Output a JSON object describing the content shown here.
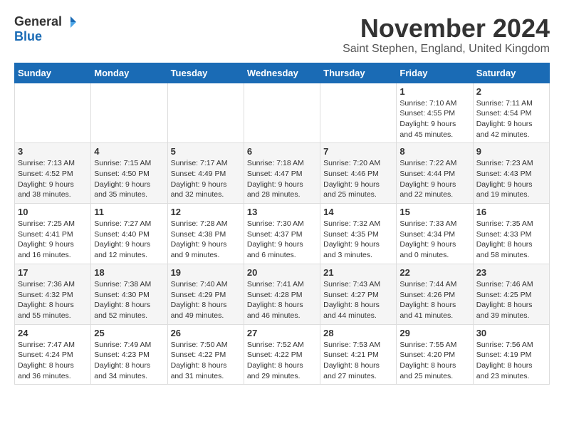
{
  "header": {
    "logo_general": "General",
    "logo_blue": "Blue",
    "month_title": "November 2024",
    "location": "Saint Stephen, England, United Kingdom"
  },
  "weekdays": [
    "Sunday",
    "Monday",
    "Tuesday",
    "Wednesday",
    "Thursday",
    "Friday",
    "Saturday"
  ],
  "weeks": [
    [
      {
        "day": "",
        "info": ""
      },
      {
        "day": "",
        "info": ""
      },
      {
        "day": "",
        "info": ""
      },
      {
        "day": "",
        "info": ""
      },
      {
        "day": "",
        "info": ""
      },
      {
        "day": "1",
        "info": "Sunrise: 7:10 AM\nSunset: 4:55 PM\nDaylight: 9 hours\nand 45 minutes."
      },
      {
        "day": "2",
        "info": "Sunrise: 7:11 AM\nSunset: 4:54 PM\nDaylight: 9 hours\nand 42 minutes."
      }
    ],
    [
      {
        "day": "3",
        "info": "Sunrise: 7:13 AM\nSunset: 4:52 PM\nDaylight: 9 hours\nand 38 minutes."
      },
      {
        "day": "4",
        "info": "Sunrise: 7:15 AM\nSunset: 4:50 PM\nDaylight: 9 hours\nand 35 minutes."
      },
      {
        "day": "5",
        "info": "Sunrise: 7:17 AM\nSunset: 4:49 PM\nDaylight: 9 hours\nand 32 minutes."
      },
      {
        "day": "6",
        "info": "Sunrise: 7:18 AM\nSunset: 4:47 PM\nDaylight: 9 hours\nand 28 minutes."
      },
      {
        "day": "7",
        "info": "Sunrise: 7:20 AM\nSunset: 4:46 PM\nDaylight: 9 hours\nand 25 minutes."
      },
      {
        "day": "8",
        "info": "Sunrise: 7:22 AM\nSunset: 4:44 PM\nDaylight: 9 hours\nand 22 minutes."
      },
      {
        "day": "9",
        "info": "Sunrise: 7:23 AM\nSunset: 4:43 PM\nDaylight: 9 hours\nand 19 minutes."
      }
    ],
    [
      {
        "day": "10",
        "info": "Sunrise: 7:25 AM\nSunset: 4:41 PM\nDaylight: 9 hours\nand 16 minutes."
      },
      {
        "day": "11",
        "info": "Sunrise: 7:27 AM\nSunset: 4:40 PM\nDaylight: 9 hours\nand 12 minutes."
      },
      {
        "day": "12",
        "info": "Sunrise: 7:28 AM\nSunset: 4:38 PM\nDaylight: 9 hours\nand 9 minutes."
      },
      {
        "day": "13",
        "info": "Sunrise: 7:30 AM\nSunset: 4:37 PM\nDaylight: 9 hours\nand 6 minutes."
      },
      {
        "day": "14",
        "info": "Sunrise: 7:32 AM\nSunset: 4:35 PM\nDaylight: 9 hours\nand 3 minutes."
      },
      {
        "day": "15",
        "info": "Sunrise: 7:33 AM\nSunset: 4:34 PM\nDaylight: 9 hours\nand 0 minutes."
      },
      {
        "day": "16",
        "info": "Sunrise: 7:35 AM\nSunset: 4:33 PM\nDaylight: 8 hours\nand 58 minutes."
      }
    ],
    [
      {
        "day": "17",
        "info": "Sunrise: 7:36 AM\nSunset: 4:32 PM\nDaylight: 8 hours\nand 55 minutes."
      },
      {
        "day": "18",
        "info": "Sunrise: 7:38 AM\nSunset: 4:30 PM\nDaylight: 8 hours\nand 52 minutes."
      },
      {
        "day": "19",
        "info": "Sunrise: 7:40 AM\nSunset: 4:29 PM\nDaylight: 8 hours\nand 49 minutes."
      },
      {
        "day": "20",
        "info": "Sunrise: 7:41 AM\nSunset: 4:28 PM\nDaylight: 8 hours\nand 46 minutes."
      },
      {
        "day": "21",
        "info": "Sunrise: 7:43 AM\nSunset: 4:27 PM\nDaylight: 8 hours\nand 44 minutes."
      },
      {
        "day": "22",
        "info": "Sunrise: 7:44 AM\nSunset: 4:26 PM\nDaylight: 8 hours\nand 41 minutes."
      },
      {
        "day": "23",
        "info": "Sunrise: 7:46 AM\nSunset: 4:25 PM\nDaylight: 8 hours\nand 39 minutes."
      }
    ],
    [
      {
        "day": "24",
        "info": "Sunrise: 7:47 AM\nSunset: 4:24 PM\nDaylight: 8 hours\nand 36 minutes."
      },
      {
        "day": "25",
        "info": "Sunrise: 7:49 AM\nSunset: 4:23 PM\nDaylight: 8 hours\nand 34 minutes."
      },
      {
        "day": "26",
        "info": "Sunrise: 7:50 AM\nSunset: 4:22 PM\nDaylight: 8 hours\nand 31 minutes."
      },
      {
        "day": "27",
        "info": "Sunrise: 7:52 AM\nSunset: 4:22 PM\nDaylight: 8 hours\nand 29 minutes."
      },
      {
        "day": "28",
        "info": "Sunrise: 7:53 AM\nSunset: 4:21 PM\nDaylight: 8 hours\nand 27 minutes."
      },
      {
        "day": "29",
        "info": "Sunrise: 7:55 AM\nSunset: 4:20 PM\nDaylight: 8 hours\nand 25 minutes."
      },
      {
        "day": "30",
        "info": "Sunrise: 7:56 AM\nSunset: 4:19 PM\nDaylight: 8 hours\nand 23 minutes."
      }
    ]
  ]
}
